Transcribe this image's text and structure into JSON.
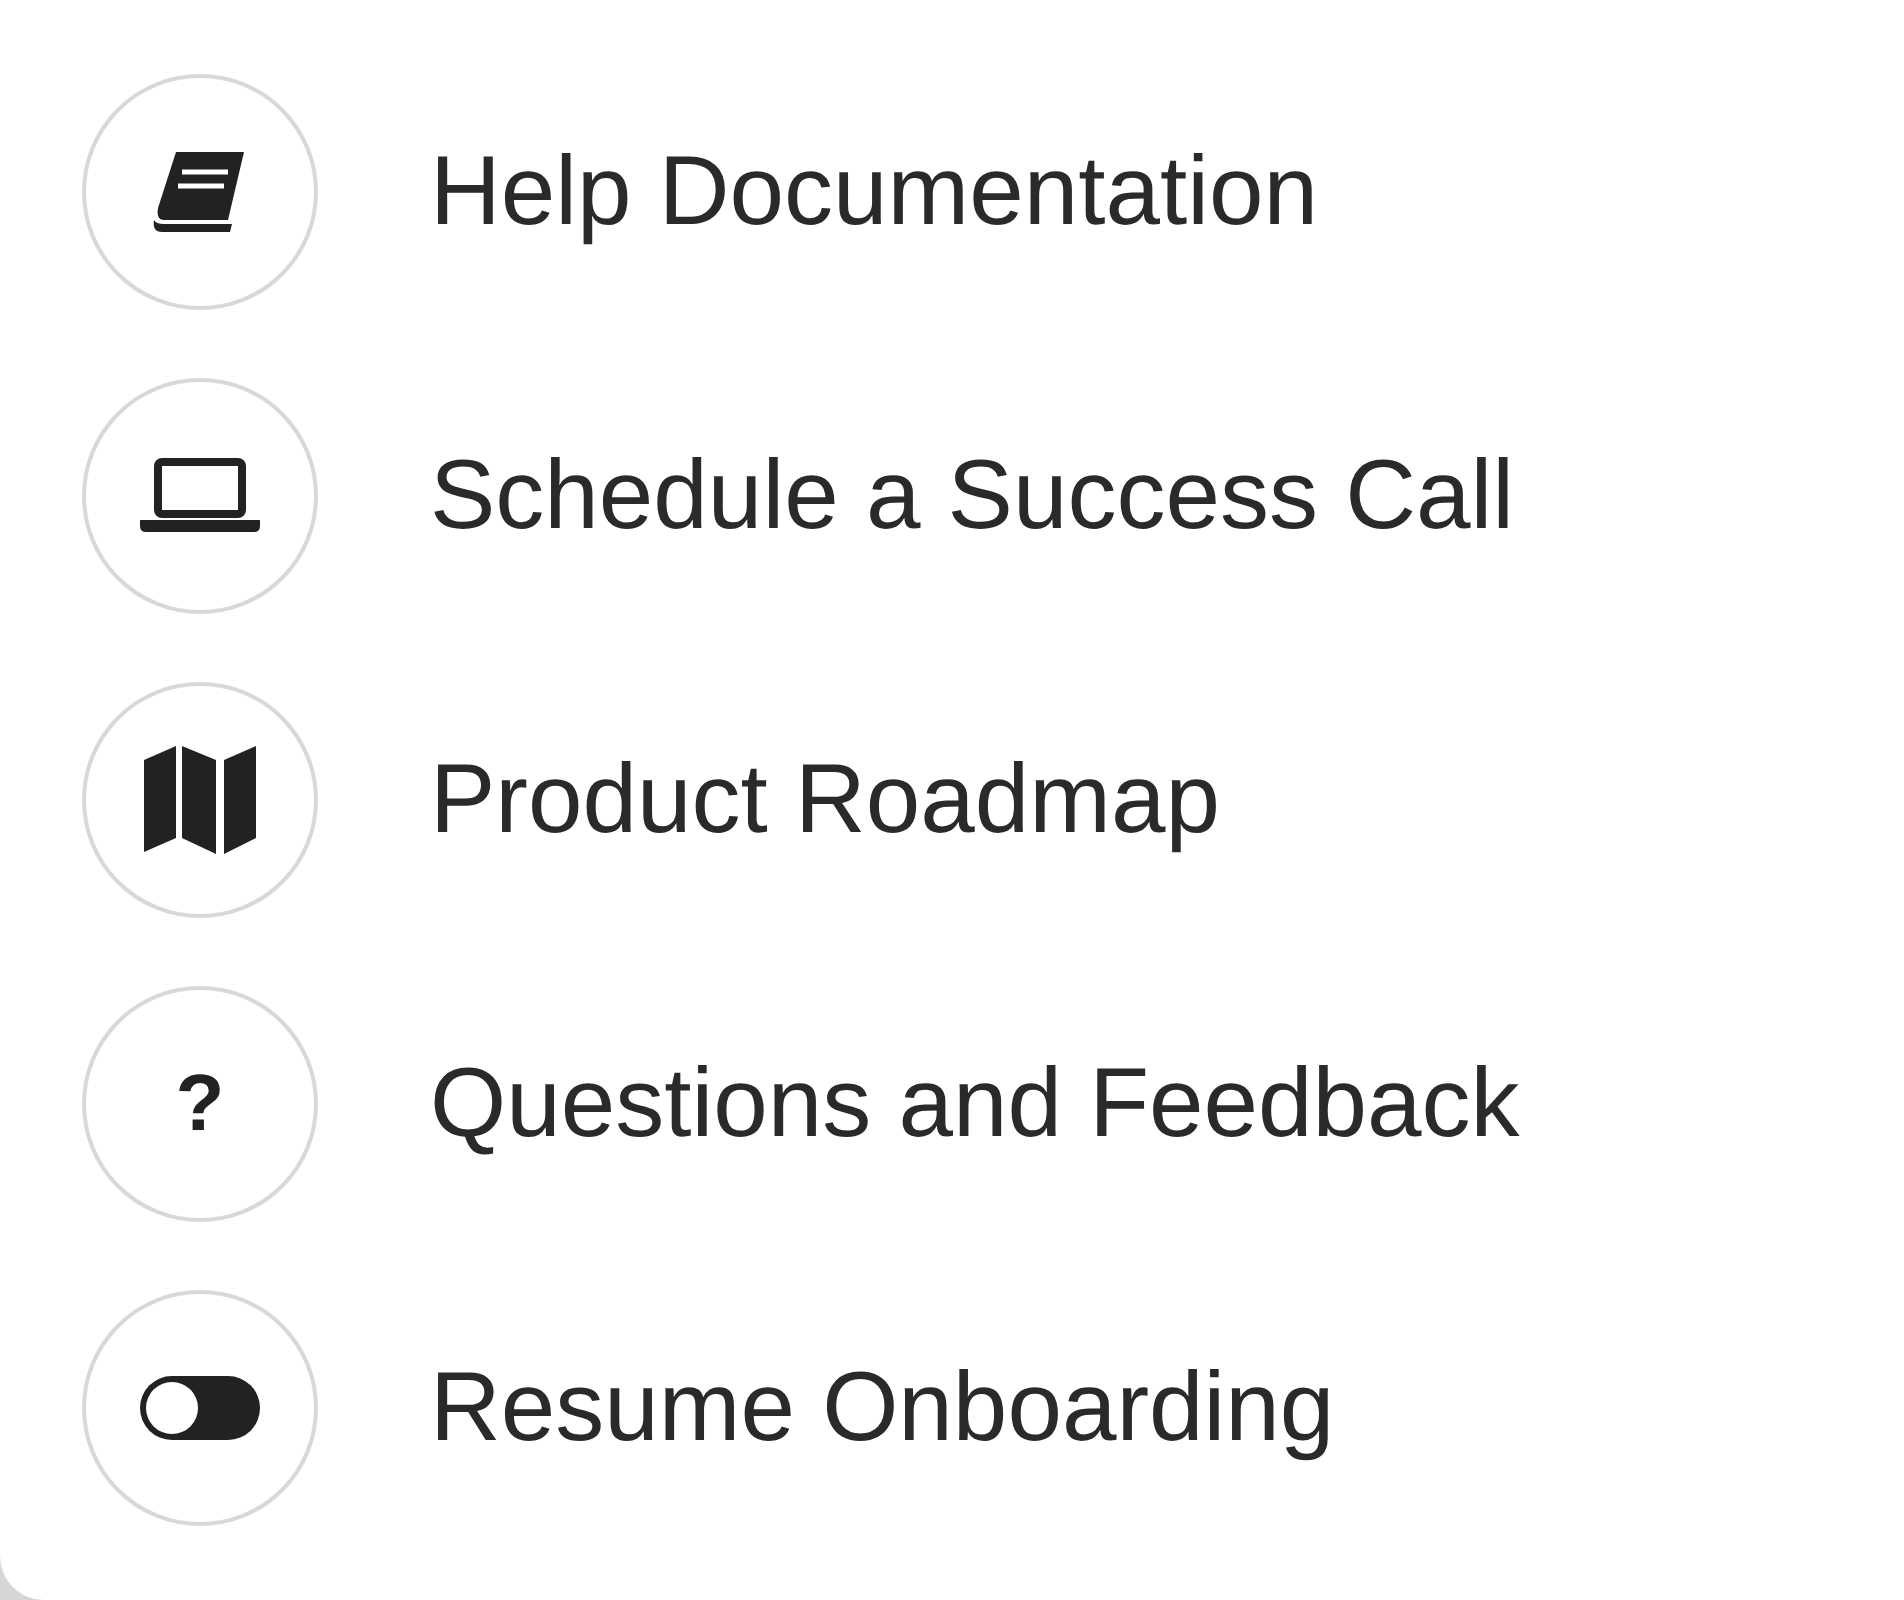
{
  "menu": {
    "items": [
      {
        "label": "Help Documentation"
      },
      {
        "label": "Schedule a Success Call"
      },
      {
        "label": "Product Roadmap"
      },
      {
        "label": "Questions and Feedback",
        "icon_text": "?"
      },
      {
        "label": "Resume Onboarding"
      }
    ]
  }
}
